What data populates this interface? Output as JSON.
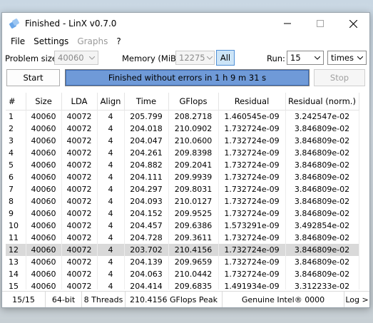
{
  "window": {
    "title": "Finished - LinX v0.7.0"
  },
  "menu": {
    "file": "File",
    "settings": "Settings",
    "graphs": "Graphs",
    "help": "?"
  },
  "controls": {
    "problem_size_label": "Problem size:",
    "problem_size_value": "40060",
    "memory_label": "Memory (MiB):",
    "memory_value": "12275",
    "all_label": "All",
    "run_label": "Run:",
    "run_value": "15",
    "run_unit": "times"
  },
  "actions": {
    "start": "Start",
    "stop": "Stop"
  },
  "progress": {
    "text": "Finished without errors in 1 h 9 m 31 s",
    "fraction": 1.0
  },
  "table": {
    "columns": [
      "#",
      "Size",
      "LDA",
      "Align",
      "Time",
      "GFlops",
      "Residual",
      "Residual (norm.)"
    ],
    "selected_row": 12,
    "rows": [
      [
        "1",
        "40060",
        "40072",
        "4",
        "205.799",
        "208.2718",
        "1.460545e-09",
        "3.242547e-02"
      ],
      [
        "2",
        "40060",
        "40072",
        "4",
        "204.018",
        "210.0902",
        "1.732724e-09",
        "3.846809e-02"
      ],
      [
        "3",
        "40060",
        "40072",
        "4",
        "204.047",
        "210.0600",
        "1.732724e-09",
        "3.846809e-02"
      ],
      [
        "4",
        "40060",
        "40072",
        "4",
        "204.261",
        "209.8398",
        "1.732724e-09",
        "3.846809e-02"
      ],
      [
        "5",
        "40060",
        "40072",
        "4",
        "204.882",
        "209.2041",
        "1.732724e-09",
        "3.846809e-02"
      ],
      [
        "6",
        "40060",
        "40072",
        "4",
        "204.111",
        "209.9939",
        "1.732724e-09",
        "3.846809e-02"
      ],
      [
        "7",
        "40060",
        "40072",
        "4",
        "204.297",
        "209.8031",
        "1.732724e-09",
        "3.846809e-02"
      ],
      [
        "8",
        "40060",
        "40072",
        "4",
        "204.093",
        "210.0127",
        "1.732724e-09",
        "3.846809e-02"
      ],
      [
        "9",
        "40060",
        "40072",
        "4",
        "204.152",
        "209.9525",
        "1.732724e-09",
        "3.846809e-02"
      ],
      [
        "10",
        "40060",
        "40072",
        "4",
        "204.457",
        "209.6386",
        "1.573291e-09",
        "3.492854e-02"
      ],
      [
        "11",
        "40060",
        "40072",
        "4",
        "204.728",
        "209.3611",
        "1.732724e-09",
        "3.846809e-02"
      ],
      [
        "12",
        "40060",
        "40072",
        "4",
        "203.702",
        "210.4156",
        "1.732724e-09",
        "3.846809e-02"
      ],
      [
        "13",
        "40060",
        "40072",
        "4",
        "204.139",
        "209.9659",
        "1.732724e-09",
        "3.846809e-02"
      ],
      [
        "14",
        "40060",
        "40072",
        "4",
        "204.063",
        "210.0442",
        "1.732724e-09",
        "3.846809e-02"
      ],
      [
        "15",
        "40060",
        "40072",
        "4",
        "204.414",
        "209.6835",
        "1.491934e-09",
        "3.312233e-02"
      ]
    ]
  },
  "status": {
    "count": "15/15",
    "arch": "64-bit",
    "threads": "8 Threads",
    "peak": "210.4156 GFlops Peak",
    "cpu": "Genuine Intel® 0000",
    "log": "Log >"
  },
  "icons": {
    "app": "linx-app-icon",
    "minimize": "minimize-icon",
    "maximize": "maximize-icon",
    "close": "close-icon",
    "dropdown": "chevron-down-icon"
  },
  "colors": {
    "progress_fill": "#6f9ad8",
    "all_button": "#cce4f7",
    "selected_row": "#d9d9d9"
  }
}
